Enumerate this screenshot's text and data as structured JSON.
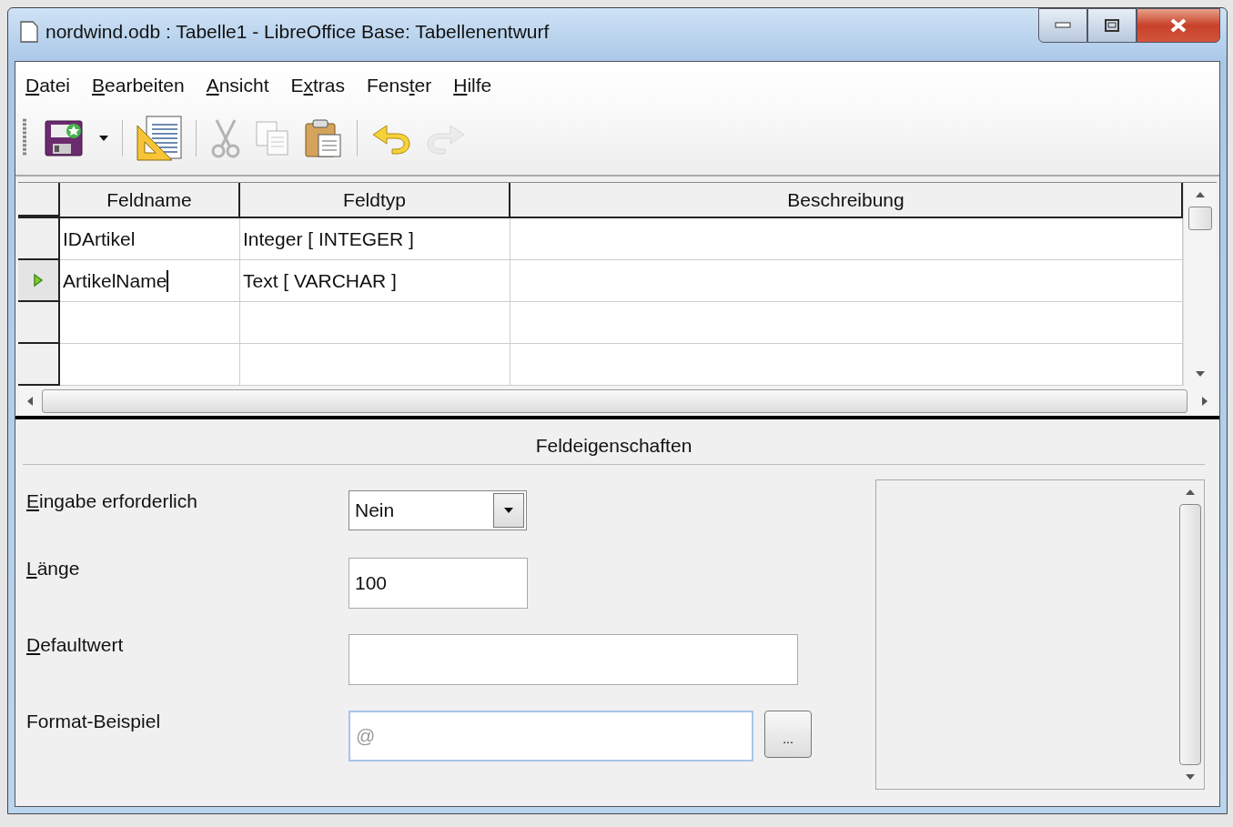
{
  "window": {
    "title": "nordwind.odb : Tabelle1 - LibreOffice Base: Tabellenentwurf"
  },
  "menu": [
    {
      "key": "D",
      "post": "atei"
    },
    {
      "key": "B",
      "post": "earbeiten"
    },
    {
      "key": "A",
      "post": "nsicht"
    },
    {
      "pre": "E",
      "key": "x",
      "post": "tras"
    },
    {
      "pre": "Fens",
      "key": "t",
      "post": "er"
    },
    {
      "key": "H",
      "post": "ilfe"
    }
  ],
  "toolbar": [
    {
      "kind": "save",
      "disabled": false
    },
    {
      "kind": "dropdown",
      "disabled": false
    },
    {
      "kind": "separator"
    },
    {
      "kind": "design",
      "disabled": false
    },
    {
      "kind": "separator"
    },
    {
      "kind": "cut",
      "disabled": true
    },
    {
      "kind": "copy",
      "disabled": true
    },
    {
      "kind": "paste",
      "disabled": false
    },
    {
      "kind": "separator"
    },
    {
      "kind": "undo",
      "disabled": false
    },
    {
      "kind": "redo",
      "disabled": true
    }
  ],
  "table": {
    "columns": [
      "Feldname",
      "Feldtyp",
      "Beschreibung"
    ],
    "rows": [
      {
        "cells": [
          "IDArtikel",
          "Integer [ INTEGER ]"
        ],
        "current": false
      },
      {
        "cells": [
          "ArtikelName",
          "Text [ VARCHAR ]"
        ],
        "current": true
      }
    ]
  },
  "properties": {
    "title": "Feldeigenschaften",
    "fields": [
      {
        "kind": "dropdown",
        "label": {
          "key": "E",
          "post": "ingabe erforderlich"
        },
        "value": "Nein"
      },
      {
        "kind": "short",
        "label": {
          "key": "L",
          "post": "änge"
        },
        "value": "100"
      },
      {
        "kind": "long",
        "label": {
          "key": "D",
          "post": "efaultwert"
        }
      },
      {
        "kind": "example",
        "label": {
          "pre": "Format-Beispiel"
        },
        "value": "@",
        "readonly": true,
        "button": "..."
      }
    ]
  }
}
